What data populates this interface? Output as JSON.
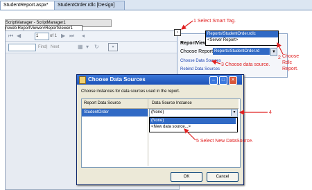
{
  "tabs": [
    {
      "label": "StudentReport.aspx*"
    },
    {
      "label": "StudentOrder.rdlc [Design]"
    }
  ],
  "designer": {
    "script_manager_label": "ScriptManager - ScriptManager1",
    "report_viewer_label": "rsweb:ReportViewer#ReportViewer1"
  },
  "viewer": {
    "page_value": "1",
    "page_label": "of 1",
    "find_label": "Find",
    "separator": "|",
    "next_label": "Next"
  },
  "smart_tag": {
    "glyph": "›"
  },
  "tasks": {
    "title": "ReportView",
    "choose_report_label": "Choose Report",
    "selected_report": "Reports\\StudentOrder.rd",
    "dropdown_options": [
      "Reports\\StudentOrder.rdlc",
      "<Server Report>"
    ],
    "link_choose_data_sources": "Choose Data Sources",
    "link_rebind": "Rebind Data Sources"
  },
  "dialog": {
    "title": "Choose Data Sources",
    "instruction": "Choose instances for data sources used in the report.",
    "columns": [
      "Report Data Source",
      "Data Source Instance"
    ],
    "rows": [
      {
        "source": "StudentOrder",
        "instance": "(None)"
      }
    ],
    "dropdown_options": [
      "(None)",
      "<New data source...>"
    ],
    "ok_label": "OK",
    "cancel_label": "Cancel"
  },
  "annotations": {
    "a1": "1  Select Smart Tag.",
    "a2_num": "2",
    "a2": "Choose Rdlc Report.",
    "a3": "3  Choose data source.",
    "a4": "4",
    "a5": "5  Select New DataSource."
  },
  "colors": {
    "annotation": "#e02020",
    "selection": "#316ac5",
    "titlebar": "#1d52b8"
  }
}
